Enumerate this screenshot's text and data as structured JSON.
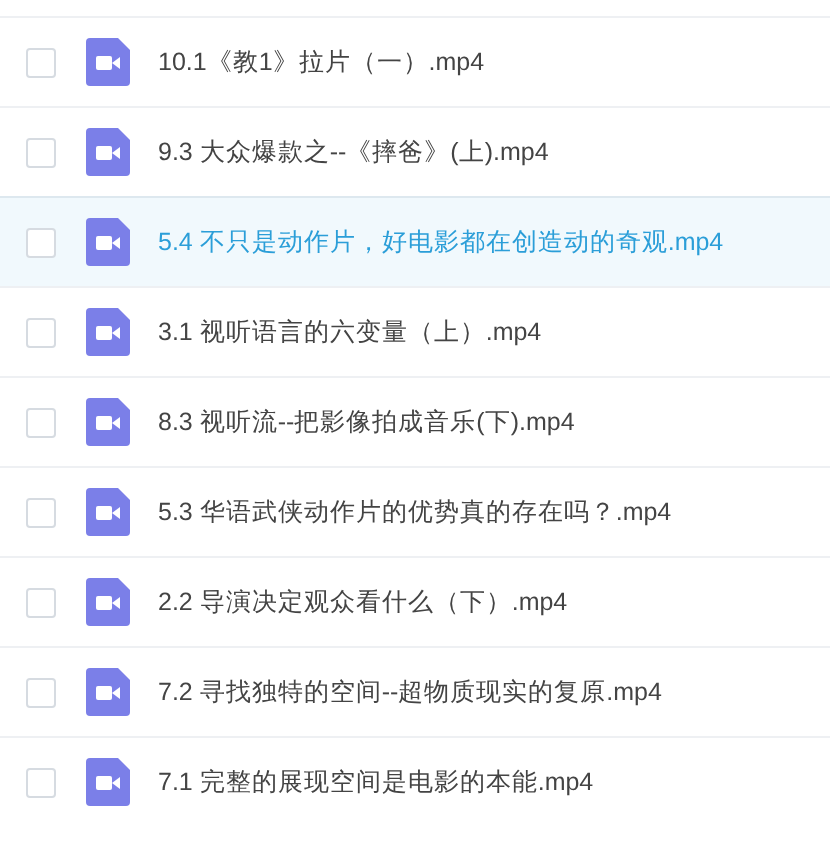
{
  "files": [
    {
      "name": "10.1《教1》拉片（一）.mp4",
      "checked": false,
      "selected": false
    },
    {
      "name": "9.3 大众爆款之--《摔爸》(上).mp4",
      "checked": false,
      "selected": false
    },
    {
      "name": "5.4 不只是动作片，好电影都在创造动的奇观.mp4",
      "checked": false,
      "selected": true
    },
    {
      "name": "3.1 视听语言的六变量（上）.mp4",
      "checked": false,
      "selected": false
    },
    {
      "name": "8.3 视听流--把影像拍成音乐(下).mp4",
      "checked": false,
      "selected": false
    },
    {
      "name": "5.3 华语武侠动作片的优势真的存在吗？.mp4",
      "checked": false,
      "selected": false
    },
    {
      "name": "2.2 导演决定观众看什么（下）.mp4",
      "checked": false,
      "selected": false
    },
    {
      "name": "7.2 寻找独特的空间--超物质现实的复原.mp4",
      "checked": false,
      "selected": false
    },
    {
      "name": "7.1 完整的展现空间是电影的本能.mp4",
      "checked": false,
      "selected": false
    }
  ]
}
